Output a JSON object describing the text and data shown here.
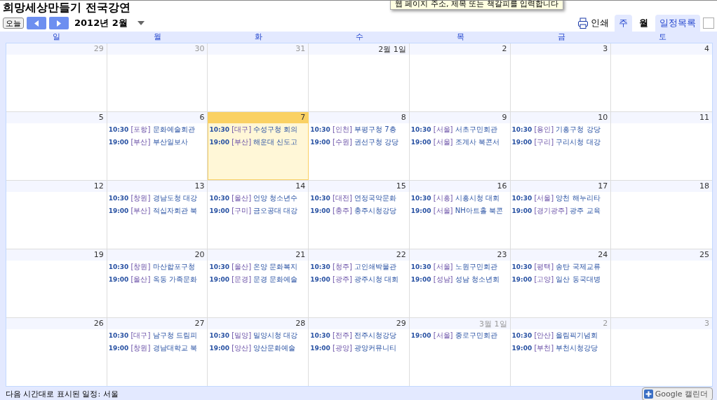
{
  "title": "희망세상만들기 전국강연",
  "tooltip": "웹 페이지 주소, 제목 또는 책갈피를 입력합니다",
  "toolbar": {
    "today_button": "오늘",
    "month_label": "2012년 2월",
    "print_label": "인쇄",
    "view_tabs": [
      {
        "label": "주",
        "selected": false
      },
      {
        "label": "월",
        "selected": true
      },
      {
        "label": "일정목록",
        "selected": false
      }
    ],
    "checkbox": {
      "checked": false
    }
  },
  "weekdays": [
    "일",
    "월",
    "화",
    "수",
    "목",
    "금",
    "토"
  ],
  "weeks": [
    {
      "days": [
        {
          "label": "29",
          "other_month": true,
          "today": false
        },
        {
          "label": "30",
          "other_month": true,
          "today": false
        },
        {
          "label": "31",
          "other_month": true,
          "today": false
        },
        {
          "label": "2월 1일",
          "other_month": false,
          "today": false
        },
        {
          "label": "2",
          "other_month": false,
          "today": false
        },
        {
          "label": "3",
          "other_month": false,
          "today": false
        },
        {
          "label": "4",
          "other_month": false,
          "today": false
        }
      ]
    },
    {
      "days": [
        {
          "label": "5",
          "other_month": false,
          "today": false
        },
        {
          "label": "6",
          "other_month": false,
          "today": false,
          "events": [
            {
              "time": "10:30",
              "place": "[포항]",
              "title": "문화예술회관"
            },
            {
              "time": "19:00",
              "place": "[부산]",
              "title": "부산일보사"
            }
          ]
        },
        {
          "label": "7",
          "other_month": false,
          "today": true,
          "events": [
            {
              "time": "10:30",
              "place": "[대구]",
              "title": "수성구청 회의"
            },
            {
              "time": "19:00",
              "place": "[부산]",
              "title": "해운대 신도고"
            }
          ]
        },
        {
          "label": "8",
          "other_month": false,
          "today": false,
          "events": [
            {
              "time": "10:30",
              "place": "[인천]",
              "title": "부평구청 7층"
            },
            {
              "time": "19:00",
              "place": "[수원]",
              "title": "권선구청 강당"
            }
          ]
        },
        {
          "label": "9",
          "other_month": false,
          "today": false,
          "events": [
            {
              "time": "10:30",
              "place": "[서울]",
              "title": "서초구민회관"
            },
            {
              "time": "19:00",
              "place": "[서울]",
              "title": "조계사 북콘서"
            }
          ]
        },
        {
          "label": "10",
          "other_month": false,
          "today": false,
          "events": [
            {
              "time": "10:30",
              "place": "[용인]",
              "title": "기흥구청 강당"
            },
            {
              "time": "19:00",
              "place": "[구리]",
              "title": "구리시청 대강"
            }
          ]
        },
        {
          "label": "11",
          "other_month": false,
          "today": false
        }
      ]
    },
    {
      "days": [
        {
          "label": "12",
          "other_month": false,
          "today": false
        },
        {
          "label": "13",
          "other_month": false,
          "today": false,
          "events": [
            {
              "time": "10:30",
              "place": "[창원]",
              "title": "경남도청 대강"
            },
            {
              "time": "19:00",
              "place": "[부산]",
              "title": "적십자회관 북"
            }
          ]
        },
        {
          "label": "14",
          "other_month": false,
          "today": false,
          "events": [
            {
              "time": "10:30",
              "place": "[울산]",
              "title": "언양 청소년수"
            },
            {
              "time": "19:00",
              "place": "[구미]",
              "title": "금오공대 대강"
            }
          ]
        },
        {
          "label": "15",
          "other_month": false,
          "today": false,
          "events": [
            {
              "time": "10:30",
              "place": "[대전]",
              "title": "연정국악문화"
            },
            {
              "time": "19:00",
              "place": "[충주]",
              "title": "충주시청강당"
            }
          ]
        },
        {
          "label": "16",
          "other_month": false,
          "today": false,
          "events": [
            {
              "time": "10:30",
              "place": "[시흥]",
              "title": "시흥시청 대회"
            },
            {
              "time": "19:00",
              "place": "[서울]",
              "title": "NH아트홀 북콘"
            }
          ]
        },
        {
          "label": "17",
          "other_month": false,
          "today": false,
          "events": [
            {
              "time": "10:30",
              "place": "[서울]",
              "title": "양천 해누리타"
            },
            {
              "time": "19:00",
              "place": "[경기광주]",
              "title": "광주 교육"
            }
          ]
        },
        {
          "label": "18",
          "other_month": false,
          "today": false
        }
      ]
    },
    {
      "days": [
        {
          "label": "19",
          "other_month": false,
          "today": false
        },
        {
          "label": "20",
          "other_month": false,
          "today": false,
          "events": [
            {
              "time": "10:30",
              "place": "[창원]",
              "title": "마산합포구청"
            },
            {
              "time": "19:00",
              "place": "[울산]",
              "title": "옥동 가족문화"
            }
          ]
        },
        {
          "label": "21",
          "other_month": false,
          "today": false,
          "events": [
            {
              "time": "10:30",
              "place": "[울산]",
              "title": "온양 문화복지"
            },
            {
              "time": "19:00",
              "place": "[문경]",
              "title": "문경 문화예술"
            }
          ]
        },
        {
          "label": "22",
          "other_month": false,
          "today": false,
          "events": [
            {
              "time": "10:30",
              "place": "[청주]",
              "title": "고인쇄박물관"
            },
            {
              "time": "19:00",
              "place": "[광주]",
              "title": "광주시청 대회"
            }
          ]
        },
        {
          "label": "23",
          "other_month": false,
          "today": false,
          "events": [
            {
              "time": "10:30",
              "place": "[서울]",
              "title": "노원구민회관"
            },
            {
              "time": "19:00",
              "place": "[성남]",
              "title": "성남 청소년회"
            }
          ]
        },
        {
          "label": "24",
          "other_month": false,
          "today": false,
          "events": [
            {
              "time": "10:30",
              "place": "[평택]",
              "title": "송탄 국제교류"
            },
            {
              "time": "19:00",
              "place": "[고양]",
              "title": "일산 동국대병"
            }
          ]
        },
        {
          "label": "25",
          "other_month": false,
          "today": false
        }
      ]
    },
    {
      "days": [
        {
          "label": "26",
          "other_month": false,
          "today": false
        },
        {
          "label": "27",
          "other_month": false,
          "today": false,
          "events": [
            {
              "time": "10:30",
              "place": "[대구]",
              "title": "남구청 드림피"
            },
            {
              "time": "19:00",
              "place": "[창원]",
              "title": "경남대학교 북"
            }
          ]
        },
        {
          "label": "28",
          "other_month": false,
          "today": false,
          "events": [
            {
              "time": "10:30",
              "place": "[밀양]",
              "title": "밀양시청 대강"
            },
            {
              "time": "19:00",
              "place": "[양산]",
              "title": "양산문화예술"
            }
          ]
        },
        {
          "label": "29",
          "other_month": false,
          "today": false,
          "events": [
            {
              "time": "10:30",
              "place": "[전주]",
              "title": "전주시청강당"
            },
            {
              "time": "19:00",
              "place": "[광양]",
              "title": "광양커뮤니티"
            }
          ]
        },
        {
          "label": "3월 1일",
          "other_month": true,
          "today": false,
          "events": [
            {
              "time": "19:00",
              "place": "[서울]",
              "title": "종로구민회관"
            }
          ]
        },
        {
          "label": "2",
          "other_month": true,
          "today": false,
          "events": [
            {
              "time": "10:30",
              "place": "[안산]",
              "title": "올림픽기념회"
            },
            {
              "time": "19:00",
              "place": "[부천]",
              "title": "부천시청강당"
            }
          ]
        },
        {
          "label": "3",
          "other_month": true,
          "today": false
        }
      ]
    }
  ],
  "footer": {
    "timezone_note": "다음 시간대로 표시된 일정: 서울",
    "google_button": "Google 캘린더"
  }
}
